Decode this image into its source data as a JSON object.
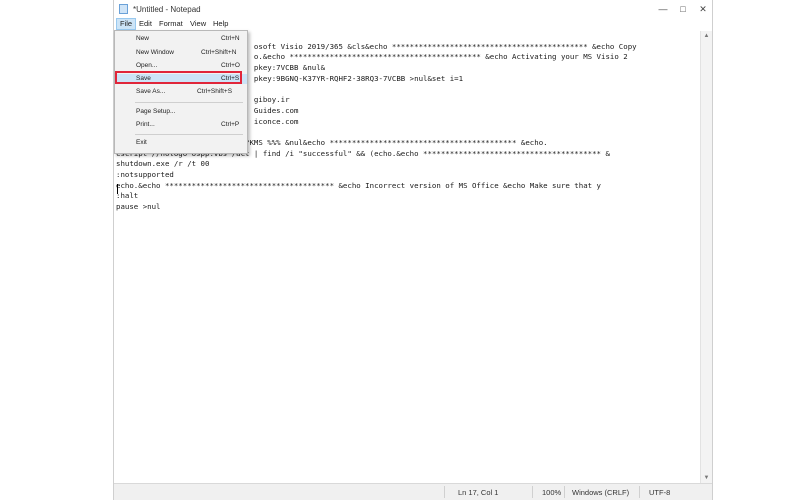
{
  "window": {
    "title": "*Untitled - Notepad",
    "minimize": "—",
    "maximize": "□",
    "close": "✕"
  },
  "menu": {
    "file": "File",
    "edit": "Edit",
    "format": "Format",
    "view": "View",
    "help": "Help"
  },
  "file_menu": {
    "new": "New",
    "new_shortcut": "Ctrl+N",
    "new_window": "New Window",
    "new_window_shortcut": "Ctrl+Shift+N",
    "open": "Open...",
    "open_shortcut": "Ctrl+O",
    "save": "Save",
    "save_shortcut": "Ctrl+S",
    "save_as": "Save As...",
    "save_as_shortcut": "Ctrl+Shift+S",
    "page_setup": "Page Setup...",
    "print": "Print...",
    "print_shortcut": "Ctrl+P",
    "exit": "Exit"
  },
  "editor": {
    "lines": [
      "",
      "                               osoft Visio 2019/365 &cls&echo ******************************************** &echo Copy",
      "                               o.&echo ******************************************* &echo Activating your MS Visio 2",
      "                               pkey:7VCBB &nul&",
      "                               pkey:9BGNQ-K37YR-RQHF2-38RQ3-7VCBB >nul&set i=1",
      "",
      "                               giboy.ir",
      "                               Guides.com",
      "                               iconce.com",
      "",
      "                          ed:?KMS %%% &nul&echo ****************************************** &echo.",
      "cscript //nologo ospp.vbs /act | find /i \"successful\" && (echo.&echo **************************************** &",
      "shutdown.exe /r /t 00",
      ":notsupported",
      "echo.&echo ************************************** &echo Incorrect version of MS Office &echo Make sure that y",
      ":halt",
      "pause >nul"
    ]
  },
  "status": {
    "position": "Ln 17, Col 1",
    "zoom": "100%",
    "line_ending": "Windows (CRLF)",
    "encoding": "UTF-8"
  }
}
